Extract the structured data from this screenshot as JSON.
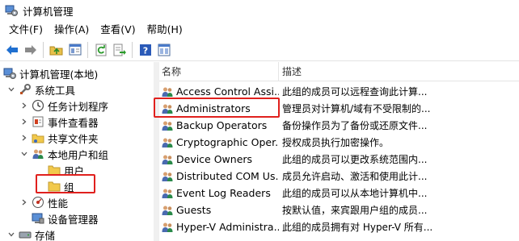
{
  "window": {
    "title": "计算机管理"
  },
  "menu": [
    {
      "label": "文件(F)"
    },
    {
      "label": "操作(A)"
    },
    {
      "label": "查看(V)"
    },
    {
      "label": "帮助(H)"
    }
  ],
  "toolbar": {
    "icons": [
      "back-arrow-icon",
      "forward-arrow-icon",
      "up-folder-icon",
      "show-hide-tree-icon",
      "refresh-icon",
      "export-list-icon",
      "help-icon",
      "properties-icon"
    ]
  },
  "tree": {
    "root": "计算机管理(本地)",
    "system_tools": "系统工具",
    "task_scheduler": "任务计划程序",
    "event_viewer": "事件查看器",
    "shared_folders": "共享文件夹",
    "local_users_groups": "本地用户和组",
    "users": "用户",
    "groups": "组",
    "performance": "性能",
    "device_manager": "设备管理器",
    "storage": "存储"
  },
  "list": {
    "columns": {
      "name": "名称",
      "description": "描述"
    },
    "rows": [
      {
        "name": "Access Control Assi...",
        "description": "此组的成员可以远程查询此计算..."
      },
      {
        "name": "Administrators",
        "description": "管理员对计算机/域有不受限制的..."
      },
      {
        "name": "Backup Operators",
        "description": "备份操作员为了备份或还原文件..."
      },
      {
        "name": "Cryptographic Oper...",
        "description": "授权成员执行加密操作。"
      },
      {
        "name": "Device Owners",
        "description": "此组的成员可以更改系统范围内..."
      },
      {
        "name": "Distributed COM Us...",
        "description": "成员允许启动、激活和使用此计..."
      },
      {
        "name": "Event Log Readers",
        "description": "此组的成员可以从本地计算机中..."
      },
      {
        "name": "Guests",
        "description": "按默认值，来宾跟用户组的成员..."
      },
      {
        "name": "Hyper-V Administra...",
        "description": "此组的成员拥有对 Hyper-V 所有..."
      }
    ]
  },
  "colors": {
    "highlight": "#e0201d",
    "folder": "#f2c94c",
    "accent": "#0a64c8"
  }
}
